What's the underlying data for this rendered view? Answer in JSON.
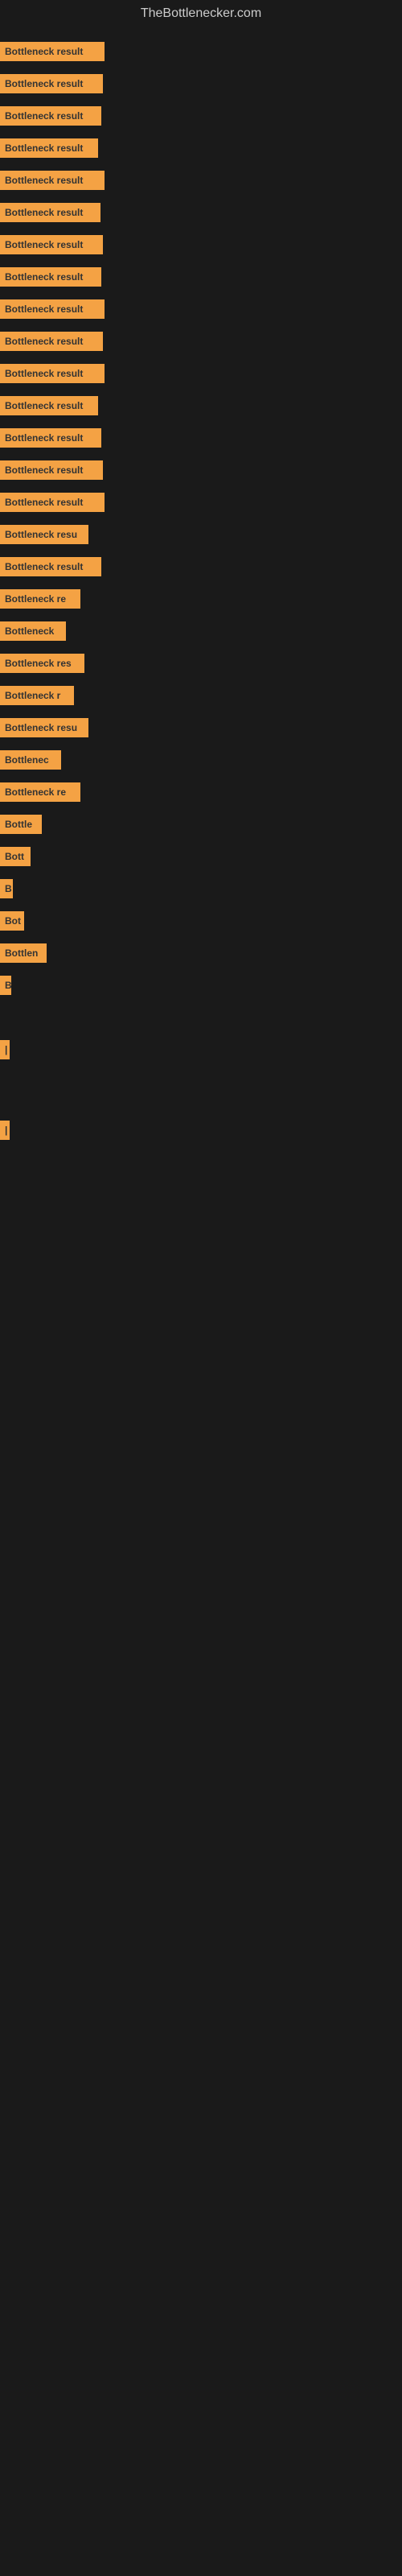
{
  "site_title": "TheBottlenecker.com",
  "bars": [
    {
      "label": "Bottleneck result",
      "width": 130
    },
    {
      "label": "Bottleneck result",
      "width": 128
    },
    {
      "label": "Bottleneck result",
      "width": 126
    },
    {
      "label": "Bottleneck result",
      "width": 122
    },
    {
      "label": "Bottleneck result",
      "width": 130
    },
    {
      "label": "Bottleneck result",
      "width": 125
    },
    {
      "label": "Bottleneck result",
      "width": 128
    },
    {
      "label": "Bottleneck result",
      "width": 126
    },
    {
      "label": "Bottleneck result",
      "width": 130
    },
    {
      "label": "Bottleneck result",
      "width": 128
    },
    {
      "label": "Bottleneck result",
      "width": 130
    },
    {
      "label": "Bottleneck result",
      "width": 122
    },
    {
      "label": "Bottleneck result",
      "width": 126
    },
    {
      "label": "Bottleneck result",
      "width": 128
    },
    {
      "label": "Bottleneck result",
      "width": 130
    },
    {
      "label": "Bottleneck resu",
      "width": 110
    },
    {
      "label": "Bottleneck result",
      "width": 126
    },
    {
      "label": "Bottleneck re",
      "width": 100
    },
    {
      "label": "Bottleneck",
      "width": 82
    },
    {
      "label": "Bottleneck res",
      "width": 105
    },
    {
      "label": "Bottleneck r",
      "width": 92
    },
    {
      "label": "Bottleneck resu",
      "width": 110
    },
    {
      "label": "Bottlenec",
      "width": 76
    },
    {
      "label": "Bottleneck re",
      "width": 100
    },
    {
      "label": "Bottle",
      "width": 52
    },
    {
      "label": "Bott",
      "width": 38
    },
    {
      "label": "B",
      "width": 16
    },
    {
      "label": "Bot",
      "width": 30
    },
    {
      "label": "Bottlen",
      "width": 58
    },
    {
      "label": "B",
      "width": 14
    },
    {
      "label": "",
      "width": 0
    },
    {
      "label": "",
      "width": 0
    },
    {
      "label": "|",
      "width": 8
    },
    {
      "label": "",
      "width": 0
    },
    {
      "label": "",
      "width": 0
    },
    {
      "label": "",
      "width": 0
    },
    {
      "label": "|",
      "width": 8
    }
  ]
}
